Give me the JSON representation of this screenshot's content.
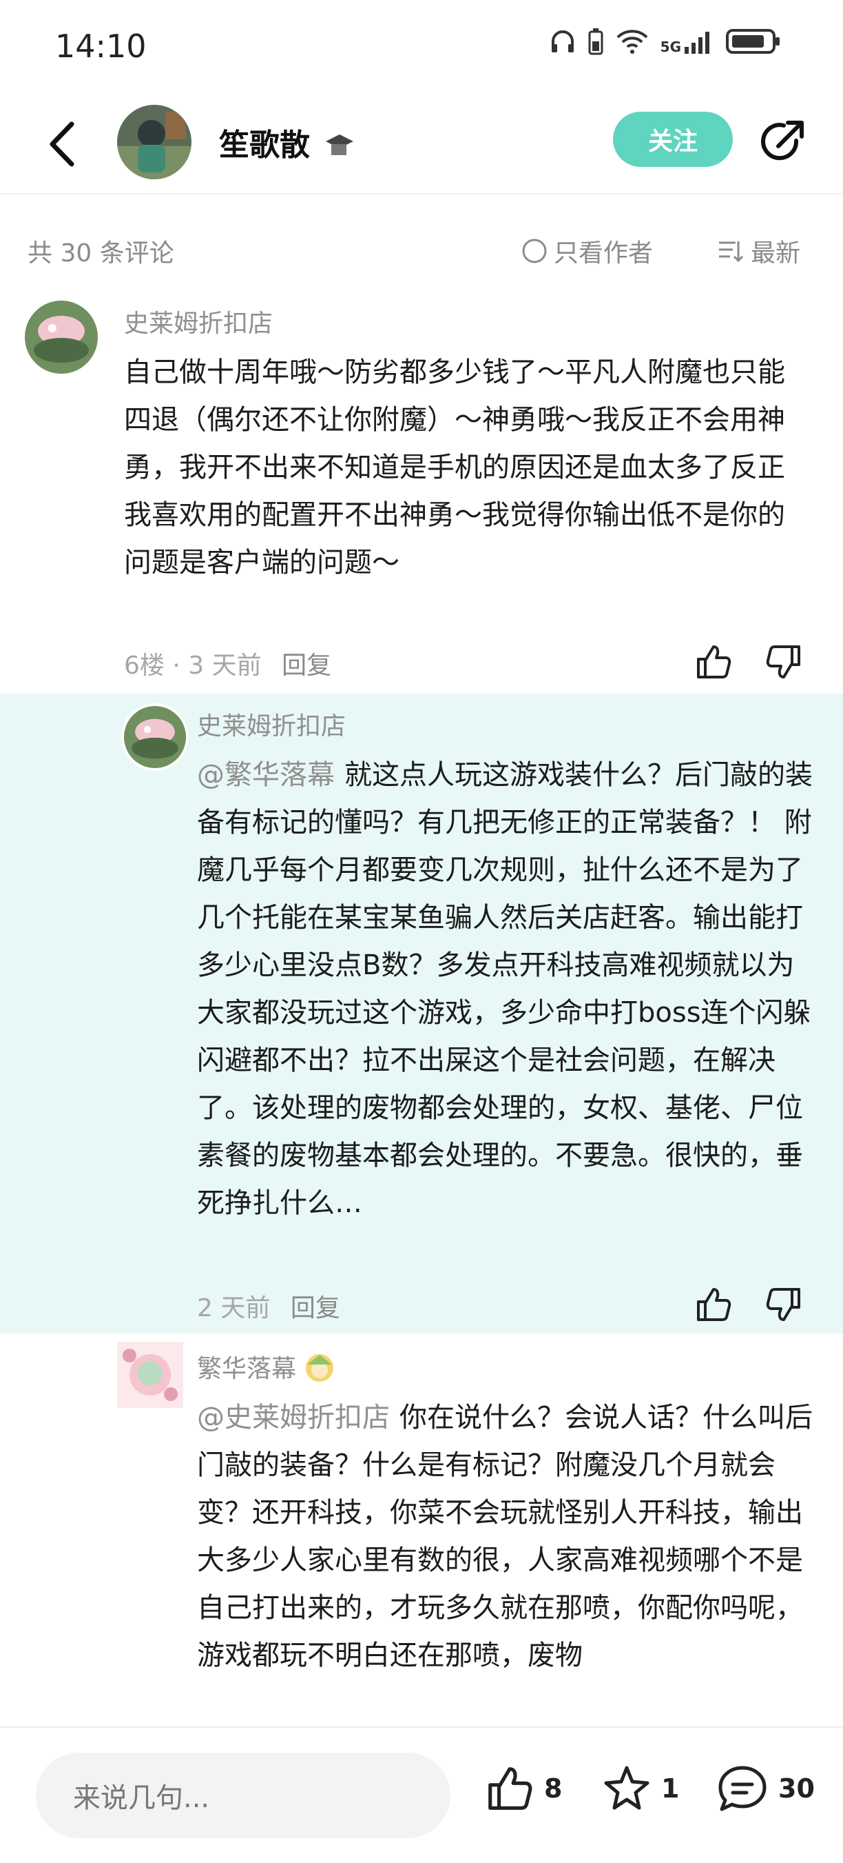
{
  "status_bar": {
    "time": "14:10",
    "network": "5G"
  },
  "header": {
    "username": "笙歌散",
    "follow_label": "关注"
  },
  "toolbar": {
    "count": "共 30 条评论",
    "only_author": "只看作者",
    "sort": "最新"
  },
  "comments": [
    {
      "name": "史莱姆折扣店",
      "text": "自己做十周年哦～防劣都多少钱了～平凡人附魔也只能四退（偶尔还不让你附魔）～神勇哦～我反正不会用神勇，我开不出来不知道是手机的原因还是血太多了反正我喜欢用的配置开不出神勇～我觉得你输出低不是你的问题是客户端的问题～",
      "floor": "6楼",
      "time": "3 天前",
      "reply": "回复"
    }
  ],
  "replies": [
    {
      "name": "史莱姆折扣店",
      "mention": "@繁华落幕",
      "text": "就这点人玩这游戏装什么？后门敲的装备有标记的懂吗？有几把无修正的正常装备？！ 附魔几乎每个月都要变几次规则，扯什么还不是为了几个托能在某宝某鱼骗人然后关店赶客。输出能打多少心里没点B数？多发点开科技高难视频就以为大家都没玩过这个游戏，多少命中打boss连个闪躲闪避都不出？拉不出屎这个是社会问题，在解决了。该处理的废物都会处理的，女权、基佬、尸位素餐的废物基本都会处理的。不要急。很快的，垂死挣扎什么…",
      "time": "2 天前",
      "reply": "回复"
    },
    {
      "name": "繁华落幕",
      "mention": "@史莱姆折扣店",
      "text": "你在说什么？会说人话？什么叫后门敲的装备？什么是有标记？附魔没几个月就会变？还开科技，你菜不会玩就怪别人开科技，输出大多少人家心里有数的很，人家高难视频哪个不是自己打出来的，才玩多久就在那喷，你配你吗呢，游戏都玩不明白还在那喷，废物"
    }
  ],
  "bottom_bar": {
    "placeholder": "来说几句...",
    "likes": "8",
    "favorites": "1",
    "comments": "30"
  }
}
